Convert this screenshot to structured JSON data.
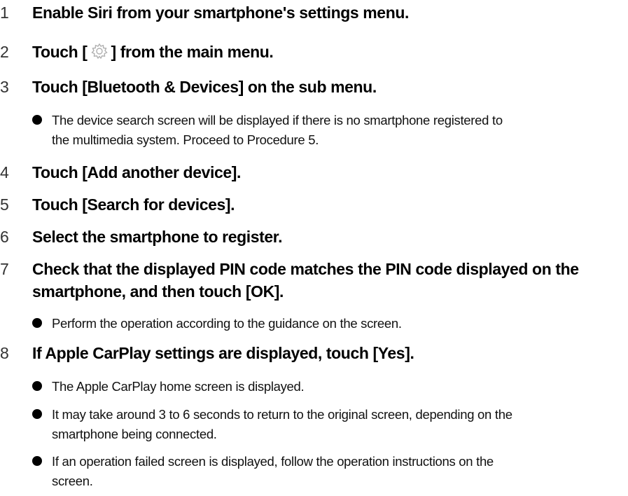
{
  "steps": [
    {
      "num": "1",
      "text": "Enable Siri from your smartphone's settings menu."
    },
    {
      "num": "2",
      "text_before": "Touch [",
      "icon": "gear-icon",
      "text_after": "] from the main menu."
    },
    {
      "num": "3",
      "text": "Touch [Bluetooth & Devices] on the sub menu.",
      "notes": [
        {
          "lines": [
            "The device search screen will be displayed if there is no smartphone registered to",
            "the multimedia system. Proceed to Procedure 5."
          ]
        }
      ]
    },
    {
      "num": "4",
      "text": "Touch [Add another device]."
    },
    {
      "num": "5",
      "text": "Touch [Search for devices]."
    },
    {
      "num": "6",
      "text": "Select the smartphone to register."
    },
    {
      "num": "7",
      "lines": [
        "Check that the displayed PIN code matches the PIN code displayed on the",
        "smartphone, and then touch [OK]."
      ],
      "notes": [
        {
          "lines": [
            "Perform the operation according to the guidance on the screen."
          ]
        }
      ]
    },
    {
      "num": "8",
      "text": "If Apple CarPlay settings are displayed, touch [Yes].",
      "notes": [
        {
          "lines": [
            "The Apple CarPlay home screen is displayed."
          ]
        },
        {
          "lines": [
            "It may take around 3 to 6 seconds to return to the original screen, depending on the",
            "smartphone being connected."
          ]
        },
        {
          "lines": [
            "If an operation failed screen is displayed, follow the operation instructions on the",
            "screen."
          ]
        }
      ]
    }
  ],
  "colors": {
    "text": "#000000",
    "step_number": "#333333",
    "icon_stroke": "#b0b0b0"
  }
}
